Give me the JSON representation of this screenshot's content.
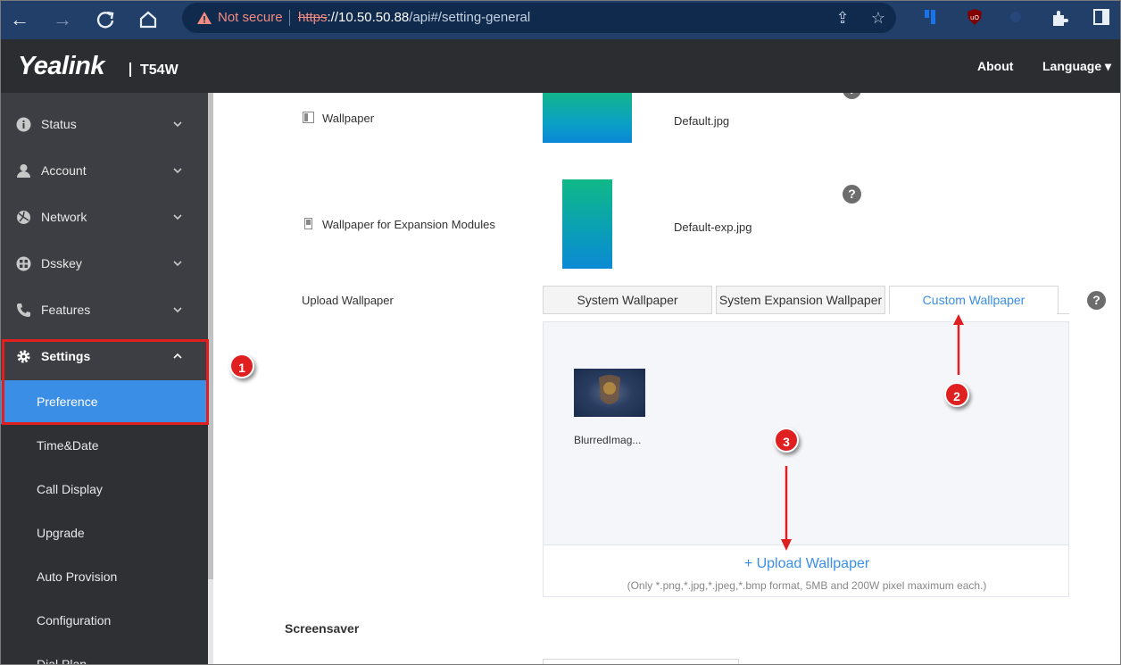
{
  "browser": {
    "not_secure": "Not secure",
    "url_scheme": "https",
    "url_host": "://10.50.50.88",
    "url_path": "/api#/setting-general"
  },
  "header": {
    "brand": "Yealink",
    "model": "T54W",
    "about": "About",
    "language": "Language ▾"
  },
  "sidebar": {
    "items": [
      {
        "label": "Status",
        "icon": "info-icon"
      },
      {
        "label": "Account",
        "icon": "user-icon"
      },
      {
        "label": "Network",
        "icon": "globe-icon"
      },
      {
        "label": "Dsskey",
        "icon": "grid-icon"
      },
      {
        "label": "Features",
        "icon": "phone-icon"
      },
      {
        "label": "Settings",
        "icon": "gear-icon"
      }
    ],
    "sub_items": [
      "Preference",
      "Time&Date",
      "Call Display",
      "Upgrade",
      "Auto Provision",
      "Configuration",
      "Dial Plan"
    ]
  },
  "content": {
    "wallpaper_label": "Wallpaper",
    "wallpaper_file": "Default.jpg",
    "exp_label": "Wallpaper for Expansion Modules",
    "exp_file": "Default-exp.jpg",
    "upload_label": "Upload Wallpaper",
    "tabs": [
      "System Wallpaper",
      "System Expansion Wallpaper",
      "Custom Wallpaper"
    ],
    "custom_file": "BlurredImag...",
    "upload_button": "+ Upload Wallpaper",
    "upload_hint": "(Only *.png,*.jpg,*.jpeg,*.bmp format, 5MB and 200W pixel maximum each.)",
    "screensaver": "Screensaver",
    "help": "?"
  },
  "annotations": [
    "1",
    "2",
    "3"
  ],
  "colors": {
    "accent": "#3a8ee6",
    "annotation_red": "#e02020",
    "header_bg": "#2b2d31",
    "sidebar_bg": "#3c3e43"
  }
}
